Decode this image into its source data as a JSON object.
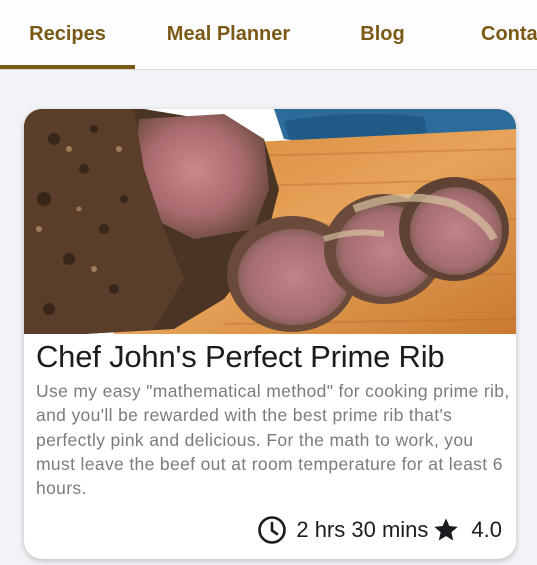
{
  "nav": {
    "tabs": [
      {
        "label": "Recipes",
        "selected": true
      },
      {
        "label": "Meal Planner",
        "selected": false
      },
      {
        "label": "Blog",
        "selected": false
      },
      {
        "label": "Conta",
        "selected": false
      }
    ]
  },
  "recipe": {
    "title": "Chef John's Perfect Prime Rib",
    "description": "Use my easy \"mathematical method\" for cooking prime rib, and you'll be rewarded with the best prime rib that's perfectly pink and delicious. For the math to work, you must leave the beef out at room temperature for at least 6 hours.",
    "time": "2 hrs 30 mins",
    "rating": "4.0",
    "time_icon": "clock-icon",
    "rating_icon": "star-icon"
  },
  "colors": {
    "accent": "#7a5a14",
    "background": "#f3f2f6",
    "card": "#ffffff",
    "title_text": "#1c1b1f",
    "body_text": "#7c7a80"
  }
}
